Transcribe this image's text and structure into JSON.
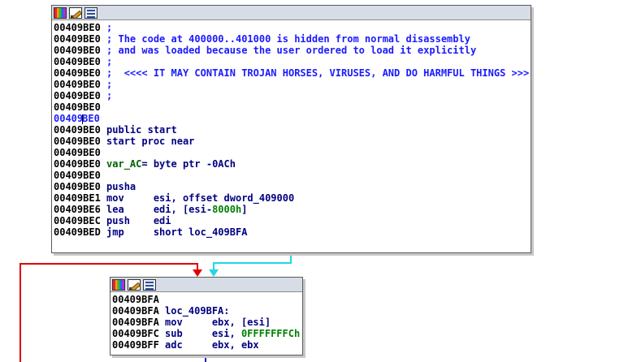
{
  "node1": {
    "lines": [
      {
        "addr": "00409BE0",
        "text": " ;",
        "kind": "cmt"
      },
      {
        "addr": "00409BE0",
        "text": " ; The code at 400000..401000 is hidden from normal disassembly",
        "kind": "cmt"
      },
      {
        "addr": "00409BE0",
        "text": " ; and was loaded because the user ordered to load it explicitly",
        "kind": "cmt"
      },
      {
        "addr": "00409BE0",
        "text": " ;",
        "kind": "cmt"
      },
      {
        "addr": "00409BE0",
        "text": " ;  <<<< IT MAY CONTAIN TROJAN HORSES, VIRUSES, AND DO HARMFUL THINGS >>>",
        "kind": "cmt"
      },
      {
        "addr": "00409BE0",
        "text": " ;",
        "kind": "cmt"
      },
      {
        "addr": "00409BE0",
        "text": " ;",
        "kind": "cmt"
      },
      {
        "addr": "00409BE0",
        "text": "",
        "kind": "plain"
      },
      {
        "addr": "00409BE0",
        "text": "",
        "kind": "plain",
        "selected": true
      },
      {
        "addr": "00409BE0",
        "text": " public start",
        "kind": "code"
      },
      {
        "addr": "00409BE0",
        "text": " start proc near",
        "kind": "code"
      },
      {
        "addr": "00409BE0",
        "text": "",
        "kind": "plain"
      },
      {
        "addr": "00409BE0",
        "text": " var_AC= byte ptr -0ACh",
        "kind": "var"
      },
      {
        "addr": "00409BE0",
        "text": "",
        "kind": "plain"
      },
      {
        "addr": "00409BE0",
        "text": " pusha",
        "kind": "code"
      },
      {
        "addr": "00409BE1",
        "text": " mov     esi, offset dword_409000",
        "kind": "code"
      },
      {
        "addr": "00409BE6",
        "text": " lea     edi, [esi-8000h]",
        "kind": "code"
      },
      {
        "addr": "00409BEC",
        "text": " push    edi",
        "kind": "code"
      },
      {
        "addr": "00409BED",
        "text": " jmp     short loc_409BFA",
        "kind": "code"
      }
    ]
  },
  "node2": {
    "lines": [
      {
        "addr": "00409BFA",
        "text": "",
        "kind": "plain"
      },
      {
        "addr": "00409BFA",
        "text": " loc_409BFA:",
        "kind": "code"
      },
      {
        "addr": "00409BFA",
        "text": " mov     ebx, [esi]",
        "kind": "code"
      },
      {
        "addr": "00409BFC",
        "text": " sub     esi, 0FFFFFFFCh",
        "kind": "code"
      },
      {
        "addr": "00409BFF",
        "text": " adc     ebx, ebx",
        "kind": "code"
      }
    ]
  },
  "icons": [
    "colors-icon",
    "edit-icon",
    "graph-icon"
  ],
  "colors": {
    "edge_true": "#e00000",
    "edge_jump": "#22d6e6",
    "edge_down": "#2020c0",
    "comment": "#1a1aff",
    "code": "#000080",
    "number": "#008000"
  }
}
